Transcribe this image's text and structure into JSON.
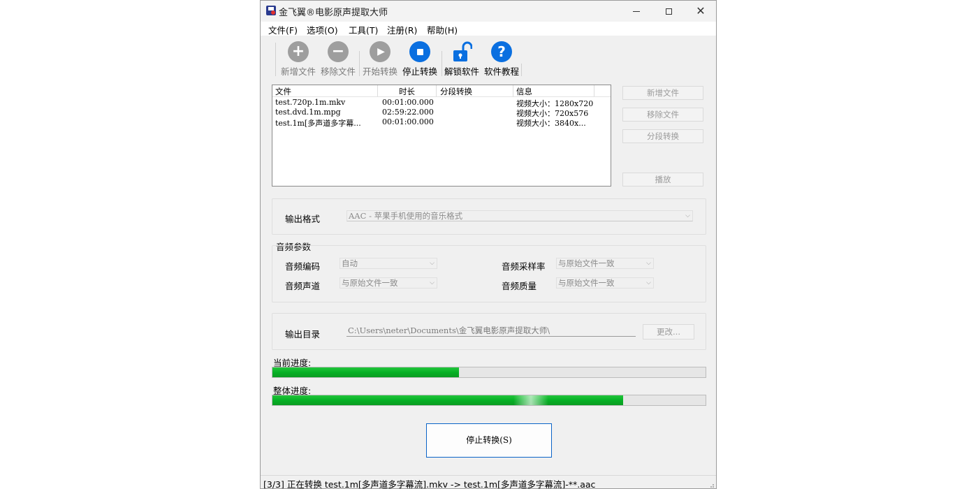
{
  "window": {
    "title": "金飞翼®电影原声提取大师"
  },
  "menu": [
    "文件(F)",
    "选项(O)",
    "工具(T)",
    "注册(R)",
    "帮助(H)"
  ],
  "toolbar": {
    "add_file": "新增文件",
    "remove_file": "移除文件",
    "start_convert": "开始转换",
    "stop_convert": "停止转换",
    "unlock": "解锁软件",
    "tutorial": "软件教程"
  },
  "file_list": {
    "columns": [
      "文件",
      "时长",
      "分段转换",
      "信息"
    ],
    "rows": [
      {
        "file": "test.720p.1m.mkv",
        "duration": "00:01:00.000",
        "segment": "",
        "info": "视频大小：1280x720"
      },
      {
        "file": "test.dvd.1m.mpg",
        "duration": "02:59:22.000",
        "segment": "",
        "info": "视频大小：720x576"
      },
      {
        "file": "test.1m[多声道多字幕...",
        "duration": "00:01:00.000",
        "segment": "",
        "info": "视频大小：3840x..."
      }
    ]
  },
  "side_buttons": {
    "add": "新增文件",
    "remove": "移除文件",
    "segment": "分段转换",
    "play": "播放"
  },
  "output_format": {
    "label": "输出格式",
    "value": "AAC - 苹果手机使用的音乐格式"
  },
  "audio_params": {
    "title": "音频参数",
    "codec_label": "音频编码",
    "codec_value": "自动",
    "samplerate_label": "音频采样率",
    "samplerate_value": "与原始文件一致",
    "channel_label": "音频声道",
    "channel_value": "与原始文件一致",
    "quality_label": "音频质量",
    "quality_value": "与原始文件一致"
  },
  "output_dir": {
    "label": "输出目录",
    "value": "C:\\Users\\neter\\Documents\\金飞翼电影原声提取大师\\",
    "change": "更改..."
  },
  "progress": {
    "current_label": "当前进度:",
    "current_fraction": 0.43,
    "overall_label": "整体进度:",
    "overall_fraction": 0.81
  },
  "stop_button": "停止转换(S)",
  "status": "[3/3] 正在转换 test.1m[多声道多字幕流].mkv -> test.1m[多声道多字幕流]-**.aac",
  "colors": {
    "accent": "#0a6fe0",
    "progress": "#06b025",
    "disabled_icon": "#9e9e9e"
  }
}
